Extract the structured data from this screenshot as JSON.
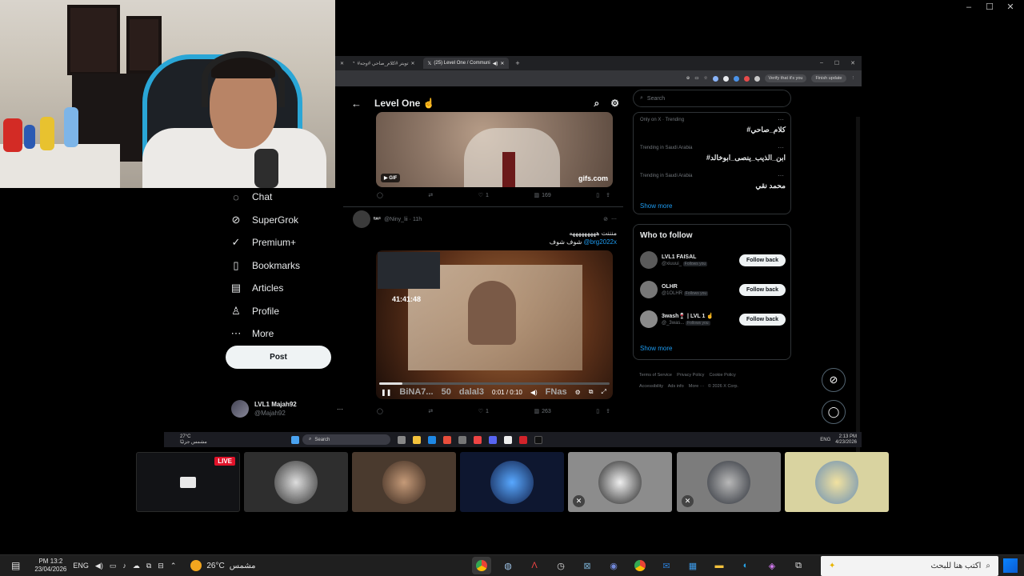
{
  "host_window": {
    "controls": [
      "–",
      "☐",
      "✕"
    ]
  },
  "captured_browser": {
    "tabs": [
      {
        "title": "#تويتر #كلام_صاحي #وجه"
      },
      {
        "title": "(25) Level One / Communi"
      }
    ],
    "new_tab": "+",
    "verify_pill": "Verify that it's you",
    "finish_update": "Finish update",
    "window_controls": [
      "–",
      "☐",
      "✕"
    ]
  },
  "x_page": {
    "header_title": "Level One ☝️",
    "gif_tweet": {
      "gif_badge": "GIF",
      "gif_source": "gifs.com",
      "likes": "1",
      "views": "169"
    },
    "tweet2": {
      "author_name": "ᵗᵘᵉ¹",
      "handle": "@Niny_lii · 11h",
      "text": "منننت هههههههههه",
      "subtext": "شوف شوف",
      "mention": "@brg2022x",
      "video": {
        "overlay_time": "41:41:48",
        "player_time": "0:01 / 0:10",
        "overlay_text_left": "BiNA7...",
        "overlay_num": "50",
        "overlay_text_mid": "dalal3",
        "overlay_right": "FNas",
        "progress_fraction": 0.1
      },
      "likes": "1",
      "views": "263"
    },
    "search_placeholder": "Search",
    "trends": [
      {
        "context": "Only on X · Trending",
        "name": "#كلام_صاحي"
      },
      {
        "context": "Trending in Saudi Arabia",
        "name": "#ابن_الذيب_ينصى_ابوخالد"
      },
      {
        "context": "Trending in Saudi Arabia",
        "name": "محمد نقي"
      }
    ],
    "show_more": "Show more",
    "who_to_follow_title": "Who to follow",
    "who_to_follow": [
      {
        "name": "LVL1 FAISAL",
        "handle": "@xiuuui_",
        "badge": "Follows you",
        "button": "Follow back"
      },
      {
        "name": "OLHR",
        "handle": "@1OLHR",
        "badge": "Follows you",
        "button": "Follow back"
      },
      {
        "name": "3wash🍷 | LVL 1 ☝️",
        "handle": "@_3was...",
        "badge": "Follows you",
        "button": "Follow back"
      }
    ],
    "show_more_2": "Show more",
    "footer_links": [
      "Terms of Service",
      "Privacy Policy",
      "Cookie Policy",
      "Accessibility",
      "Ads info",
      "More ···",
      "© 2026 X Corp."
    ]
  },
  "captured_taskbar": {
    "weather_temp": "27°C",
    "weather_desc": "مشمس جزئيًا",
    "search": "Search",
    "lang": "ENG",
    "time": "2:13 PM",
    "date": "4/23/2026"
  },
  "x_nav": {
    "items": [
      {
        "label": "Chat",
        "icon": "chat-icon",
        "glyph": "◌"
      },
      {
        "label": "SuperGrok",
        "icon": "grok-icon",
        "glyph": "⊘"
      },
      {
        "label": "Premium+",
        "icon": "premium-icon",
        "glyph": "✓"
      },
      {
        "label": "Bookmarks",
        "icon": "bookmark-icon",
        "glyph": "▯"
      },
      {
        "label": "Articles",
        "icon": "articles-icon",
        "glyph": "▤"
      },
      {
        "label": "Profile",
        "icon": "profile-icon",
        "glyph": "♙"
      },
      {
        "label": "More",
        "icon": "more-icon",
        "glyph": "⋯"
      }
    ],
    "post_button": "Post",
    "account": {
      "name": "LVL1 Majah92",
      "handle": "@Majah92",
      "dots": "···"
    }
  },
  "participants": {
    "live_badge": "LIVE"
  },
  "taskbar": {
    "time": "PM 13:2",
    "date": "23/04/2026",
    "lang": "ENG",
    "temperature": "26°C",
    "weather_desc": "مشمس",
    "search_placeholder": "اكتب هنا للبحث"
  },
  "colors": {
    "accent": "#1d9bf0",
    "x_bg": "#000000",
    "live": "#e1132a"
  }
}
